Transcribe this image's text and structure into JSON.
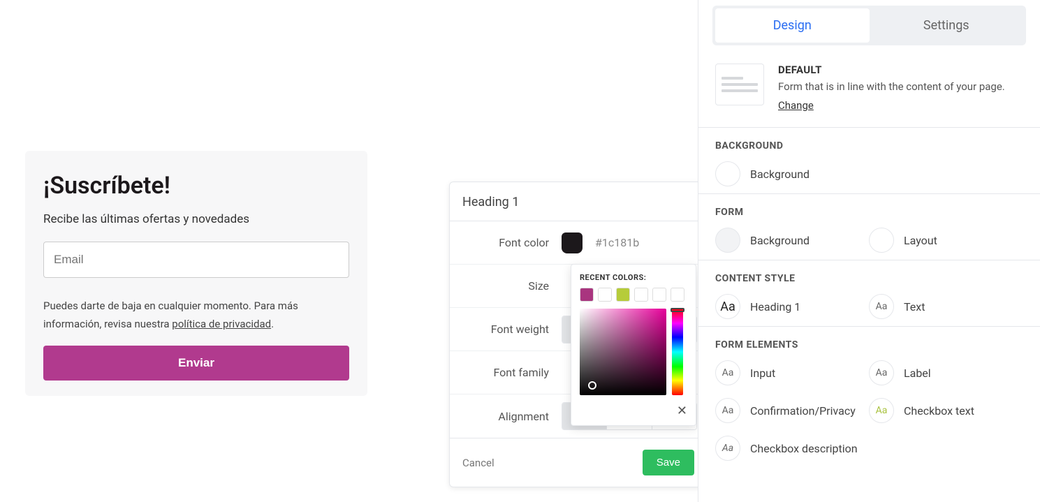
{
  "preview": {
    "title": "¡Suscríbete!",
    "subtitle": "Recibe las últimas ofertas y novedades",
    "email_placeholder": "Email",
    "privacy_prefix": "Puedes darte de baja en cualquier momento. Para más información, revisa nuestra ",
    "privacy_link": "política de privacidad",
    "privacy_suffix": ".",
    "submit": "Enviar",
    "submit_bg": "#b13a8e"
  },
  "popup": {
    "title": "Heading 1",
    "rows": {
      "font_color": "Font color",
      "size": "Size",
      "font_weight": "Font weight",
      "font_family": "Font family",
      "alignment": "Alignment"
    },
    "font_color_value": "#1c181b",
    "cancel": "Cancel",
    "save": "Save"
  },
  "colorpicker": {
    "recent_label": "RECENT COLORS:",
    "recent": [
      "#a9357f",
      "#ffffff",
      "#b6cc3a",
      "#ffffff",
      "#ffffff",
      "#ffffff"
    ],
    "close": "✕"
  },
  "sidebar": {
    "tabs": {
      "design": "Design",
      "settings": "Settings",
      "active": "design"
    },
    "default": {
      "heading": "DEFAULT",
      "desc": "Form that is in line with the content of your page.",
      "change": "Change"
    },
    "sections": {
      "background": {
        "head": "BACKGROUND",
        "items": [
          {
            "label": "Background",
            "chip": ""
          }
        ]
      },
      "form": {
        "head": "FORM",
        "items": [
          {
            "label": "Background",
            "chip": ""
          },
          {
            "label": "Layout",
            "chip": ""
          }
        ]
      },
      "content_style": {
        "head": "CONTENT STYLE",
        "items": [
          {
            "label": "Heading 1",
            "chip": "Aa"
          },
          {
            "label": "Text",
            "chip": "Aa"
          }
        ]
      },
      "form_elements": {
        "head": "FORM ELEMENTS",
        "items": [
          {
            "label": "Input",
            "chip": "Aa"
          },
          {
            "label": "Label",
            "chip": "Aa"
          },
          {
            "label": "Confirmation/Privacy",
            "chip": "Aa"
          },
          {
            "label": "Checkbox text",
            "chip": "Aa"
          },
          {
            "label": "Checkbox description",
            "chip": "Aa"
          }
        ]
      }
    }
  }
}
